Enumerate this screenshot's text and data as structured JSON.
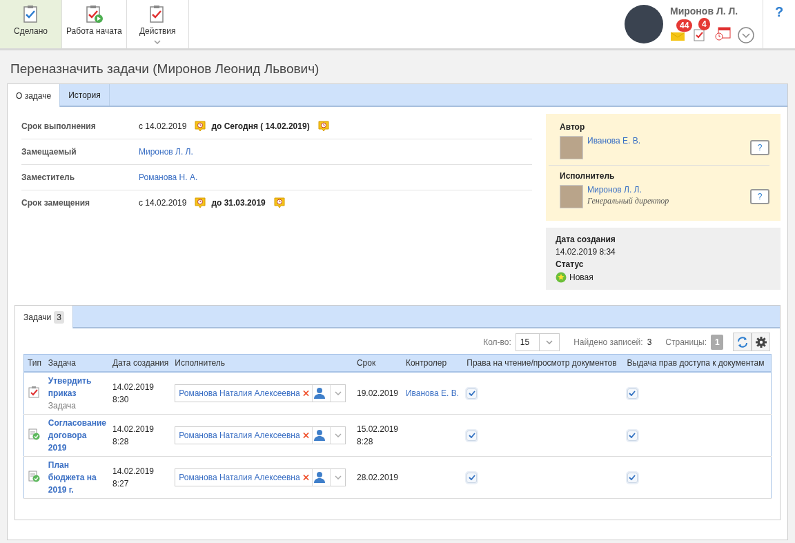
{
  "toolbar": {
    "buttons": [
      {
        "label": "Сделано",
        "kind": "done",
        "selected": true,
        "dropdown": false
      },
      {
        "label": "Работа начата",
        "kind": "started",
        "selected": false,
        "dropdown": false
      },
      {
        "label": "Действия",
        "kind": "actions",
        "selected": false,
        "dropdown": true
      }
    ]
  },
  "user": {
    "name": "Миронов Л. Л.",
    "badges": [
      {
        "kind": "mail",
        "count": "44"
      },
      {
        "kind": "tasks",
        "count": "4"
      },
      {
        "kind": "calendar"
      }
    ]
  },
  "help": "?",
  "page_title": "Переназначить задачи (Миронов Леонид Львович)",
  "tabs": [
    {
      "label": "О задаче",
      "selected": true
    },
    {
      "label": "История",
      "selected": false
    }
  ],
  "fields": [
    {
      "label": "Срок выполнения",
      "kind": "period",
      "from": "с 14.02.2019",
      "to": "до Сегодня ( 14.02.2019)"
    },
    {
      "label": "Замещаемый",
      "kind": "link",
      "value": "Миронов Л. Л."
    },
    {
      "label": "Заместитель",
      "kind": "link",
      "value": "Романова Н. А."
    },
    {
      "label": "Срок замещения",
      "kind": "period",
      "from": "с 14.02.2019",
      "to": "до 31.03.2019"
    }
  ],
  "people": [
    {
      "heading": "Автор",
      "name": "Иванова Е. В.",
      "help": "?"
    },
    {
      "heading": "Исполнитель",
      "name": "Миронов Л. Л.",
      "role": "Генеральный директор",
      "help": "?"
    }
  ],
  "info": {
    "created_label": "Дата создания",
    "created": "14.02.2019 8:34",
    "status_label": "Статус",
    "status": "Новая"
  },
  "tasks_tab": {
    "label": "Задачи",
    "count": "3",
    "selected": true
  },
  "pager": {
    "count_label": "Кол-во:",
    "count": "15",
    "found_label": "Найдено записей:",
    "found": "3",
    "pages_label": "Страницы:",
    "page": "1"
  },
  "table": {
    "columns": [
      "Тип",
      "Задача",
      "Дата создания",
      "Исполнитель",
      "Срок",
      "Контролер",
      "Права на чтение/просмотр документов",
      "Выдача прав доступа к документам"
    ],
    "rows": [
      {
        "kind": "task",
        "title": "Утвердить приказ",
        "subtitle": "Задача",
        "created": "14.02.2019 8:30",
        "executor": "Романова Наталия Алексеевна",
        "due": "19.02.2019",
        "controller": "Иванова Е. В.",
        "read": true,
        "grant": true
      },
      {
        "kind": "approval",
        "title": "Согласование договора 2019",
        "created": "14.02.2019 8:28",
        "executor": "Романова Наталия Алексеевна",
        "due": "15.02.2019 8:28",
        "read": true,
        "grant": true
      },
      {
        "kind": "approval",
        "title": "План бюджета на 2019 г.",
        "created": "14.02.2019 8:27",
        "executor": "Романова Наталия Алексеевна",
        "due": "28.02.2019",
        "read": true,
        "grant": true
      }
    ]
  }
}
